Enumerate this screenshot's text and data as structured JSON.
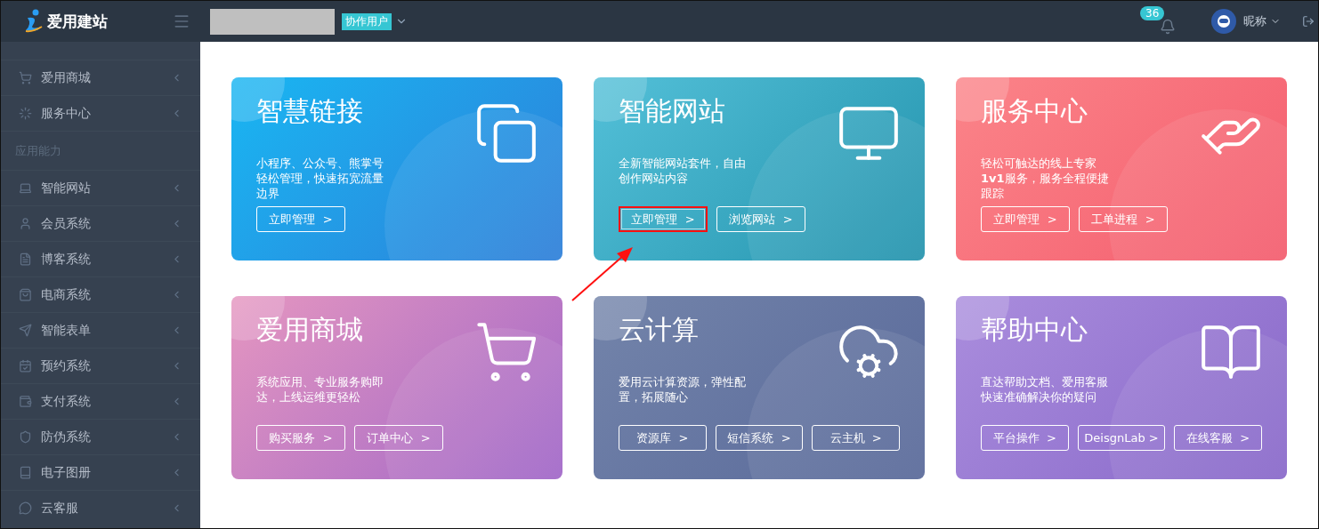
{
  "topbar": {
    "logo": "爱用建站",
    "role_badge": "协作用户",
    "notifications": "36",
    "user_name": "昵称"
  },
  "sidebar": {
    "items": [
      {
        "kind": "item",
        "label": "爱用商城"
      },
      {
        "kind": "item",
        "label": "服务中心"
      },
      {
        "kind": "header",
        "label": "应用能力"
      },
      {
        "kind": "item",
        "label": "智能网站"
      },
      {
        "kind": "item",
        "label": "会员系统"
      },
      {
        "kind": "item",
        "label": "博客系统"
      },
      {
        "kind": "item",
        "label": "电商系统"
      },
      {
        "kind": "item",
        "label": "智能表单"
      },
      {
        "kind": "item",
        "label": "预约系统"
      },
      {
        "kind": "item",
        "label": "支付系统"
      },
      {
        "kind": "item",
        "label": "防伪系统"
      },
      {
        "kind": "item",
        "label": "电子图册"
      },
      {
        "kind": "item",
        "label": "云客服"
      }
    ]
  },
  "cards": [
    {
      "title": "智慧链接",
      "description": [
        "小程序、公众号、熊掌号",
        "轻松管理，快速拓宽流量",
        "边界"
      ],
      "buttons": [
        {
          "label": "立即管理  >",
          "highlighted": false
        }
      ]
    },
    {
      "title": "智能网站",
      "description": [
        "全新智能网站套件，自由",
        "创作网站内容"
      ],
      "buttons": [
        {
          "label": "立即管理  >",
          "highlighted": true
        },
        {
          "label": "浏览网站  >",
          "highlighted": false
        }
      ]
    },
    {
      "title": "服务中心",
      "description": [
        "轻松可触达的线上专家",
        "**1v1**服务，服务全程便捷",
        "跟踪"
      ],
      "buttons": [
        {
          "label": "立即管理  >",
          "highlighted": false
        },
        {
          "label": "工单进程  >",
          "highlighted": false
        }
      ]
    },
    {
      "title": "爱用商城",
      "description": [
        "系统应用、专业服务购即",
        "达，上线运维更轻松"
      ],
      "buttons": [
        {
          "label": "购买服务  >",
          "highlighted": false
        },
        {
          "label": "订单中心  >",
          "highlighted": false
        }
      ]
    },
    {
      "title": "云计算",
      "description": [
        "爱用云计算资源，弹性配",
        "置，拓展随心"
      ],
      "buttons": [
        {
          "label": "资源库  >",
          "highlighted": false
        },
        {
          "label": "短信系统  >",
          "highlighted": false
        },
        {
          "label": "云主机  >",
          "highlighted": false
        }
      ]
    },
    {
      "title": "帮助中心",
      "description": [
        "直达帮助文档、爱用客服",
        "快速准确解决你的疑问"
      ],
      "buttons": [
        {
          "label": "平台操作  >",
          "highlighted": false
        },
        {
          "label": "DeisgnLab >",
          "highlighted": false
        },
        {
          "label": "在线客服  >",
          "highlighted": false
        }
      ]
    }
  ]
}
